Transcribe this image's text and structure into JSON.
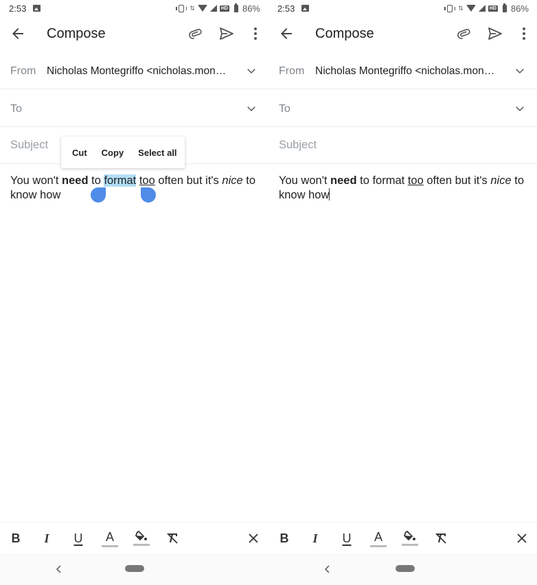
{
  "screens": [
    {
      "id": "left",
      "status_bar": {
        "time": "2:53",
        "battery": "86%"
      },
      "app_bar": {
        "title": "Compose",
        "icons": [
          "back-arrow-icon",
          "attach-icon",
          "send-icon",
          "more-vert-icon"
        ]
      },
      "fields": {
        "from_label": "From",
        "from_value": "Nicholas Montegriffo <nicholas.mon…",
        "to_label": "To",
        "subject_placeholder": "Subject"
      },
      "body": {
        "parts": [
          "You won't ",
          "need",
          " to ",
          "format",
          " ",
          "too",
          " often but it's ",
          "nice",
          " to know how"
        ],
        "selected_word": "format"
      },
      "context_menu": {
        "cut": "Cut",
        "copy": "Copy",
        "select_all": "Select all"
      },
      "format_toolbar": {
        "bold": "B",
        "italic": "I",
        "underline": "U",
        "text_color": "A"
      }
    },
    {
      "id": "right",
      "status_bar": {
        "time": "2:53",
        "battery": "86%"
      },
      "app_bar": {
        "title": "Compose",
        "icons": [
          "back-arrow-icon",
          "attach-icon",
          "send-icon",
          "more-vert-icon"
        ]
      },
      "fields": {
        "from_label": "From",
        "from_value": "Nicholas Montegriffo <nicholas.mon…",
        "to_label": "To",
        "subject_placeholder": "Subject"
      },
      "body": {
        "parts": [
          "You won't ",
          "need",
          " to format ",
          "too",
          " often but it's ",
          "nice",
          " to know how"
        ]
      },
      "format_toolbar": {
        "bold": "B",
        "italic": "I",
        "underline": "U",
        "text_color": "A"
      }
    }
  ],
  "colors": {
    "selection_highlight": "#b3def4",
    "selection_handle": "#4f8ce8",
    "text_primary": "#202124",
    "label_gray": "#80868b"
  }
}
